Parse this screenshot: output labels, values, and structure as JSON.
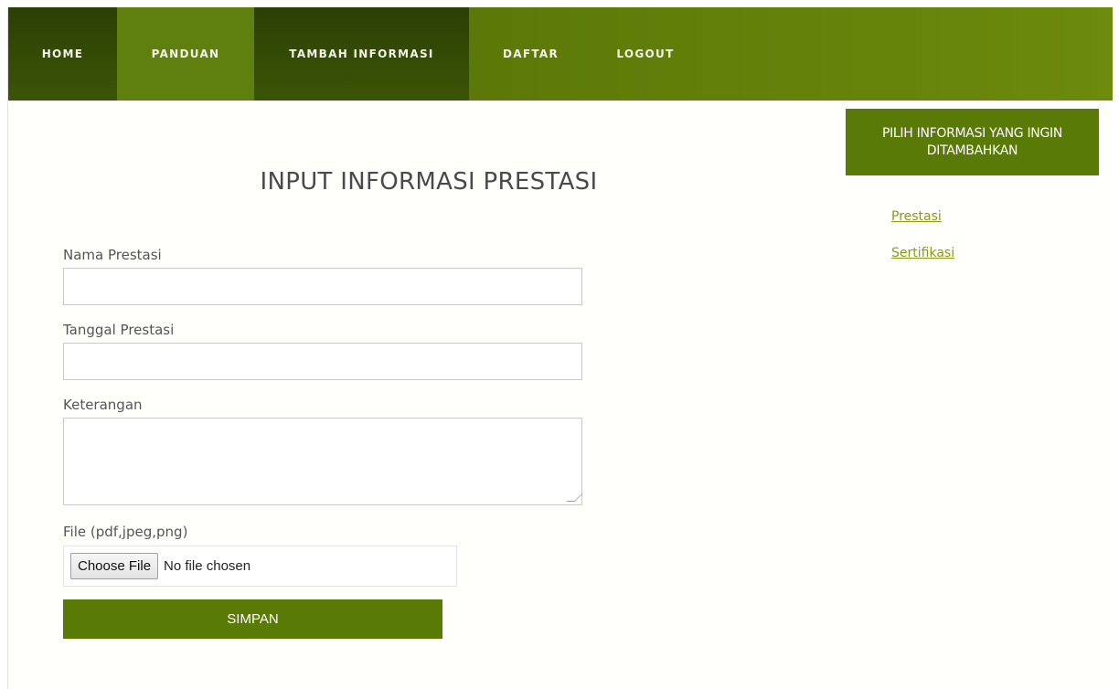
{
  "nav": {
    "items": [
      {
        "label": "HOME"
      },
      {
        "label": "PANDUAN"
      },
      {
        "label": "TAMBAH INFORMASI"
      },
      {
        "label": "DAFTAR"
      },
      {
        "label": "LOGOUT"
      }
    ]
  },
  "form": {
    "title": "INPUT INFORMASI PRESTASI",
    "fields": {
      "nama_label": "Nama Prestasi",
      "nama_value": "",
      "tanggal_label": "Tanggal Prestasi",
      "tanggal_value": "",
      "keterangan_label": "Keterangan",
      "keterangan_value": "",
      "file_label": "File (pdf,jpeg,png)",
      "file_button": "Choose File",
      "file_status": "No file chosen"
    },
    "submit_label": "SIMPAN"
  },
  "sidebar": {
    "header": "PILIH INFORMASI YANG INGIN DITAMBAHKAN",
    "links": [
      {
        "label": "Prestasi"
      },
      {
        "label": "Sertifikasi"
      }
    ]
  },
  "colors": {
    "nav_green": "#5e7b08",
    "nav_dark": "#2c3f04",
    "button_green": "#597a05",
    "link_green": "#8a9a18"
  }
}
